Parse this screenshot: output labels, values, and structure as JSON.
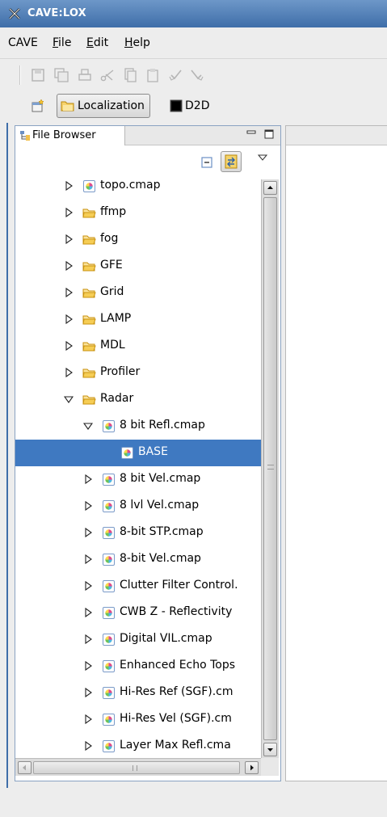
{
  "window": {
    "title": "CAVE:LOX"
  },
  "menubar": {
    "items": [
      {
        "label": "CAVE"
      },
      {
        "label": "File",
        "mnemonic": "F",
        "rest": "ile"
      },
      {
        "label": "Edit",
        "mnemonic": "E",
        "rest": "dit"
      },
      {
        "label": "Help",
        "mnemonic": "H",
        "rest": "elp"
      }
    ]
  },
  "toolbar": {
    "icons": [
      "save-icon",
      "save-all-icon",
      "print-icon",
      "cut-icon",
      "copy-icon",
      "paste-icon",
      "undo-icon",
      "redo-icon"
    ],
    "disabled": true
  },
  "perspectives": {
    "items": [
      {
        "label": "Localization",
        "active": true
      },
      {
        "label": "D2D",
        "active": false
      }
    ]
  },
  "file_browser": {
    "tab_label": "File Browser",
    "rows": [
      {
        "label": "topo.cmap",
        "type": "cmap",
        "expanded": false,
        "depth": 1
      },
      {
        "label": "ffmp",
        "type": "folder",
        "expanded": false,
        "depth": 1
      },
      {
        "label": "fog",
        "type": "folder",
        "expanded": false,
        "depth": 1
      },
      {
        "label": "GFE",
        "type": "folder",
        "expanded": false,
        "depth": 1
      },
      {
        "label": "Grid",
        "type": "folder",
        "expanded": false,
        "depth": 1
      },
      {
        "label": "LAMP",
        "type": "folder",
        "expanded": false,
        "depth": 1
      },
      {
        "label": "MDL",
        "type": "folder",
        "expanded": false,
        "depth": 1
      },
      {
        "label": "Profiler",
        "type": "folder",
        "expanded": false,
        "depth": 1
      },
      {
        "label": "Radar",
        "type": "folder",
        "expanded": true,
        "depth": 1
      },
      {
        "label": "8 bit Refl.cmap",
        "type": "cmap",
        "expanded": true,
        "depth": 2
      },
      {
        "label": "BASE",
        "type": "cmap",
        "leaf": true,
        "selected": true,
        "depth": 3
      },
      {
        "label": "8 bit Vel.cmap",
        "type": "cmap",
        "expanded": false,
        "depth": 2
      },
      {
        "label": "8 lvl Vel.cmap",
        "type": "cmap",
        "expanded": false,
        "depth": 2
      },
      {
        "label": "8-bit STP.cmap",
        "type": "cmap",
        "expanded": false,
        "depth": 2
      },
      {
        "label": "8-bit Vel.cmap",
        "type": "cmap",
        "expanded": false,
        "depth": 2
      },
      {
        "label": "Clutter Filter Control.",
        "type": "cmap",
        "expanded": false,
        "depth": 2
      },
      {
        "label": "CWB Z - Reflectivity",
        "type": "cmap",
        "expanded": false,
        "depth": 2
      },
      {
        "label": "Digital VIL.cmap",
        "type": "cmap",
        "expanded": false,
        "depth": 2
      },
      {
        "label": "Enhanced Echo Tops",
        "type": "cmap",
        "expanded": false,
        "depth": 2
      },
      {
        "label": "Hi-Res Ref (SGF).cm",
        "type": "cmap",
        "expanded": false,
        "depth": 2
      },
      {
        "label": "Hi-Res Vel (SGF).cm",
        "type": "cmap",
        "expanded": false,
        "depth": 2
      },
      {
        "label": "Layer Max Refl.cma",
        "type": "cmap",
        "expanded": false,
        "depth": 2
      }
    ]
  },
  "colors": {
    "title_bar": "#4f7cb5",
    "selection": "#3f79c1",
    "folder": "#f2c14e",
    "cmap_icon": "#e05a9a"
  }
}
